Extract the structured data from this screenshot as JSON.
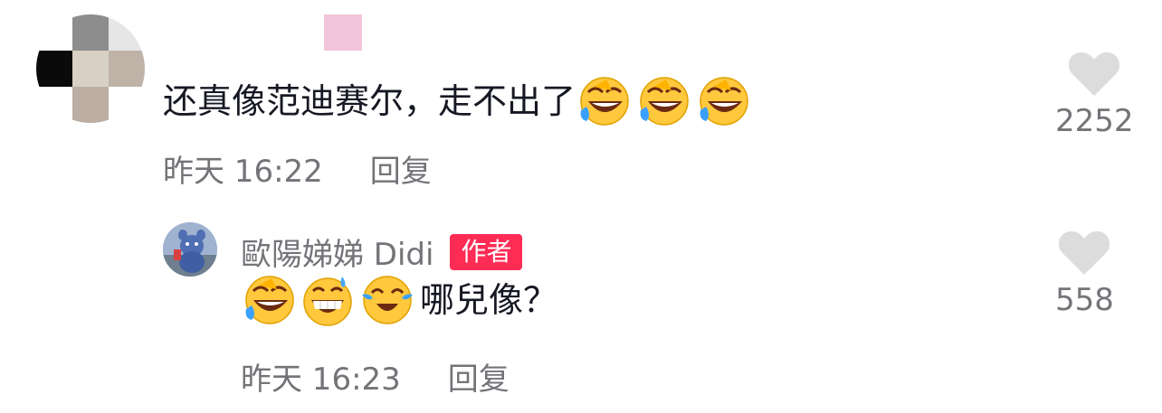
{
  "comment": {
    "username": "",
    "text": "还真像范迪赛尔，走不出了",
    "emojis": [
      "rolling-laughing-emoji",
      "rolling-laughing-emoji",
      "rolling-laughing-emoji"
    ],
    "time": "昨天 16:22",
    "reply_label": "回复",
    "likes": "2252"
  },
  "reply": {
    "username": "歐陽娣娣 Didi",
    "badge": "作者",
    "emojis": [
      "rolling-laughing-emoji",
      "grinning-sweat-emoji",
      "tears-of-joy-emoji"
    ],
    "text": "哪兒像？",
    "time": "昨天 16:23",
    "reply_label": "回复",
    "likes": "558"
  },
  "colors": {
    "badge": "#fe2c55",
    "meta_text": "#737478",
    "heart": "#dcdcdc",
    "primary_text": "#161823"
  }
}
